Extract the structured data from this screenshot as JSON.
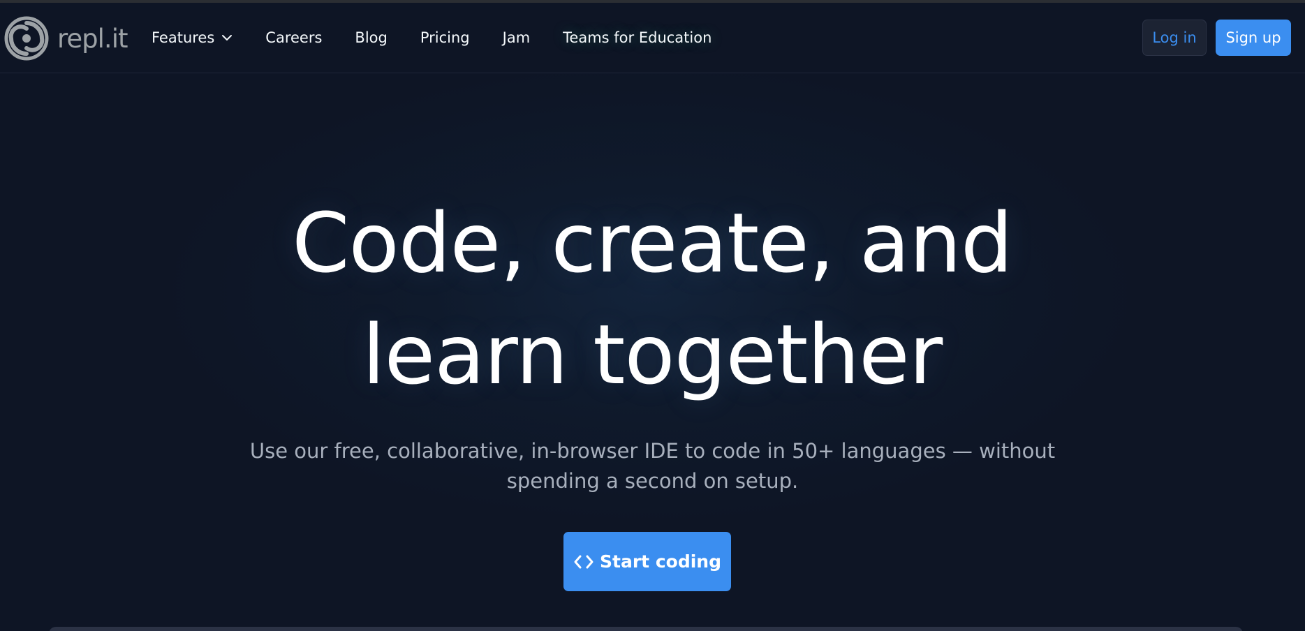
{
  "brand": {
    "name": "repl.it",
    "logo_color": "#9da2a6"
  },
  "nav": {
    "links": [
      {
        "label": "Features",
        "has_dropdown": true
      },
      {
        "label": "Careers"
      },
      {
        "label": "Blog"
      },
      {
        "label": "Pricing"
      },
      {
        "label": "Jam"
      },
      {
        "label": "Teams for Education"
      }
    ],
    "login_label": "Log in",
    "signup_label": "Sign up"
  },
  "hero": {
    "title_line1": "Code, create, and",
    "title_line2": "learn together",
    "subtitle_line1": "Use our free, collaborative, in-browser IDE to code in 50+ languages — without",
    "subtitle_line2": "spending a second on setup.",
    "cta_label": "Start coding"
  },
  "colors": {
    "background": "#0e1525",
    "accent": "#3b8ef0",
    "text": "#f5f9fc",
    "muted_text": "#a8b0bd"
  },
  "icons": {
    "logo": "replit-spiral-icon",
    "features_dropdown": "chevron-down-icon",
    "cta": "code-brackets-icon"
  }
}
